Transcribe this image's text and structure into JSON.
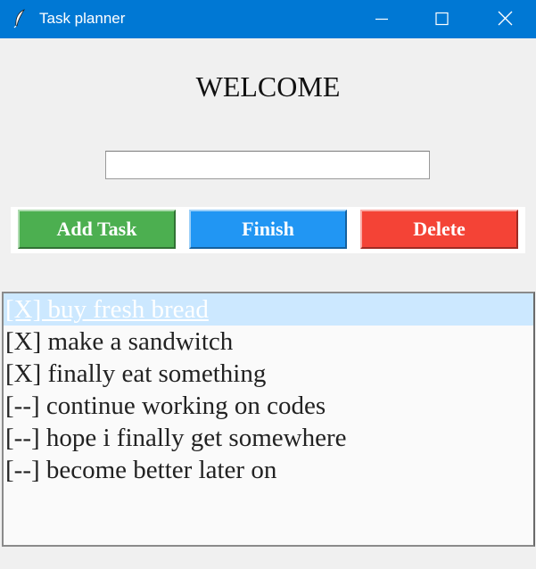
{
  "window": {
    "title": "Task planner",
    "app_icon": "feather-icon",
    "controls": [
      "minimize-icon",
      "maximize-icon",
      "close-icon"
    ]
  },
  "header": {
    "welcome": "WELCOME"
  },
  "task_input": {
    "value": "",
    "placeholder": ""
  },
  "buttons": {
    "add": "Add Task",
    "finish": "Finish",
    "delete": "Delete"
  },
  "colors": {
    "titlebar": "#0078d4",
    "add": "#4caf50",
    "finish": "#2196f3",
    "delete": "#f44336",
    "selection": "#cce8ff"
  },
  "tasks": [
    {
      "label": "[X] buy fresh bread",
      "selected": true
    },
    {
      "label": "[X] make a sandwitch",
      "selected": false
    },
    {
      "label": "[X] finally eat something",
      "selected": false
    },
    {
      "label": "[--] continue working on codes",
      "selected": false
    },
    {
      "label": "[--] hope i finally get somewhere",
      "selected": false
    },
    {
      "label": "[--] become better later on",
      "selected": false
    }
  ]
}
